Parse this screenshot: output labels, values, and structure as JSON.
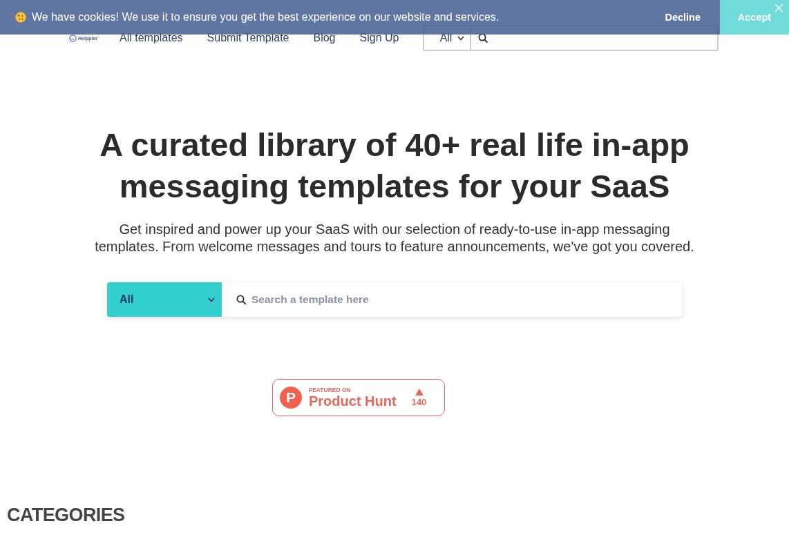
{
  "cookie_banner": {
    "message": "We have cookies! We use it to ensure you get the best experience on our website and services.",
    "decline": "Decline",
    "accept": "Accept"
  },
  "header": {
    "logo": "Helppier",
    "nav": [
      "All templates",
      "Submit Template",
      "Blog",
      "Sign Up"
    ],
    "search": {
      "category": "All"
    }
  },
  "hero": {
    "title": "A curated library of 40+ real life in-app messaging templates for your SaaS",
    "subtitle": "Get inspired and power up your SaaS with our selection of ready-to-use in-app messaging templates. From welcome messages and tours to feature announcements, we've got you covered.",
    "search": {
      "category": "All",
      "placeholder": "Search a template here"
    }
  },
  "product_hunt_badge": {
    "logo_letter": "P",
    "kicker": "FEATURED ON",
    "name": "Product Hunt",
    "votes": "140"
  },
  "categories": {
    "heading": "CATEGORIES"
  }
}
